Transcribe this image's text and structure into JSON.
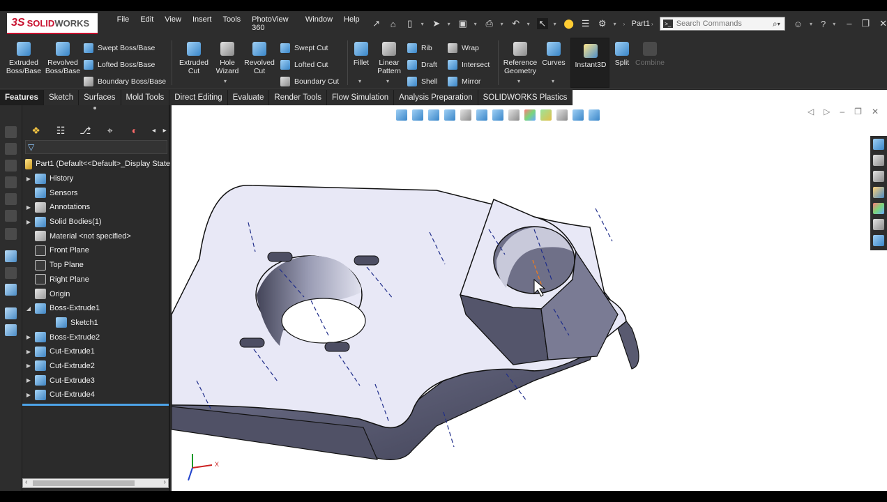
{
  "logo": {
    "ds": "3S",
    "solid": "SOLID",
    "works": "WORKS"
  },
  "menu": [
    "File",
    "Edit",
    "View",
    "Insert",
    "Tools",
    "PhotoView 360",
    "Window",
    "Help"
  ],
  "document_name": "Part1",
  "search": {
    "placeholder": "Search Commands"
  },
  "ribbon": {
    "extruded_boss": "Extruded Boss/Base",
    "revolved_boss": "Revolved Boss/Base",
    "swept_boss": "Swept Boss/Base",
    "lofted_boss": "Lofted Boss/Base",
    "boundary_boss": "Boundary Boss/Base",
    "extruded_cut": "Extruded Cut",
    "hole_wizard": "Hole Wizard",
    "revolved_cut": "Revolved Cut",
    "swept_cut": "Swept Cut",
    "lofted_cut": "Lofted Cut",
    "boundary_cut": "Boundary Cut",
    "fillet": "Fillet",
    "linear_pattern": "Linear Pattern",
    "rib": "Rib",
    "draft": "Draft",
    "shell": "Shell",
    "wrap": "Wrap",
    "intersect": "Intersect",
    "mirror": "Mirror",
    "reference_geometry": "Reference Geometry",
    "curves": "Curves",
    "instant3d": "Instant3D",
    "split": "Split",
    "combine": "Combine"
  },
  "tabs": [
    "Features",
    "Sketch",
    "Surfaces",
    "Mold Tools",
    "Direct Editing",
    "Evaluate",
    "Render Tools",
    "Flow Simulation",
    "Analysis Preparation",
    "SOLIDWORKS Plastics"
  ],
  "tree": {
    "root": "Part1  (Default<<Default>_Display State",
    "items": [
      {
        "label": "History",
        "expandable": true,
        "indent": 1,
        "icon": "history-icon"
      },
      {
        "label": "Sensors",
        "expandable": false,
        "indent": 1,
        "icon": "sensor-icon"
      },
      {
        "label": "Annotations",
        "expandable": true,
        "indent": 1,
        "icon": "annotation-icon"
      },
      {
        "label": "Solid Bodies(1)",
        "expandable": true,
        "indent": 1,
        "icon": "solid-bodies-icon"
      },
      {
        "label": "Material <not specified>",
        "expandable": false,
        "indent": 1,
        "icon": "material-icon"
      },
      {
        "label": "Front Plane",
        "expandable": false,
        "indent": 1,
        "icon": "plane-icon"
      },
      {
        "label": "Top Plane",
        "expandable": false,
        "indent": 1,
        "icon": "plane-icon"
      },
      {
        "label": "Right Plane",
        "expandable": false,
        "indent": 1,
        "icon": "plane-icon"
      },
      {
        "label": "Origin",
        "expandable": false,
        "indent": 1,
        "icon": "origin-icon"
      },
      {
        "label": "Boss-Extrude1",
        "expandable": true,
        "expanded": true,
        "indent": 1,
        "icon": "extrude-icon"
      },
      {
        "label": "Sketch1",
        "expandable": false,
        "indent": 2,
        "icon": "sketch-icon"
      },
      {
        "label": "Boss-Extrude2",
        "expandable": true,
        "indent": 1,
        "icon": "extrude-icon"
      },
      {
        "label": "Cut-Extrude1",
        "expandable": true,
        "indent": 1,
        "icon": "cut-icon"
      },
      {
        "label": "Cut-Extrude2",
        "expandable": true,
        "indent": 1,
        "icon": "cut-icon"
      },
      {
        "label": "Cut-Extrude3",
        "expandable": true,
        "indent": 1,
        "icon": "cut-icon"
      },
      {
        "label": "Cut-Extrude4",
        "expandable": true,
        "indent": 1,
        "icon": "cut-icon"
      }
    ]
  },
  "triad": {
    "x_label": "X"
  },
  "colors": {
    "accent": "#4da3e8",
    "brand": "#c8102e",
    "panel": "#2b2b2b",
    "model_face": "#e8e8f6",
    "model_side": "#5a5a72"
  }
}
